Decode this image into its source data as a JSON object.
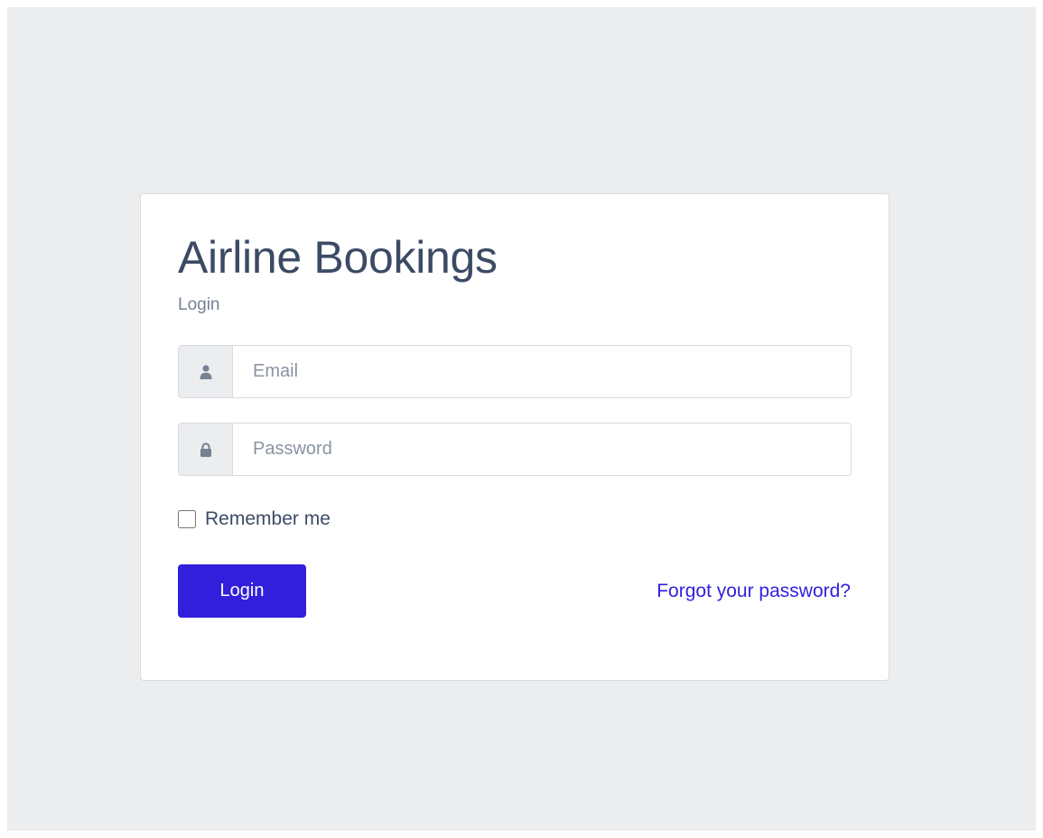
{
  "login_card": {
    "title": "Airline Bookings",
    "subtitle": "Login",
    "email": {
      "placeholder": "Email",
      "value": "",
      "icon": "user-icon"
    },
    "password": {
      "placeholder": "Password",
      "value": "",
      "icon": "lock-icon"
    },
    "remember_me": {
      "label": "Remember me",
      "checked": false
    },
    "login_button": {
      "label": "Login"
    },
    "forgot_password": {
      "label": "Forgot your password?"
    }
  },
  "colors": {
    "background": "#ebedef",
    "card": "#ffffff",
    "primary": "#321fdb",
    "text": "#3c4b64",
    "muted": "#768192"
  }
}
